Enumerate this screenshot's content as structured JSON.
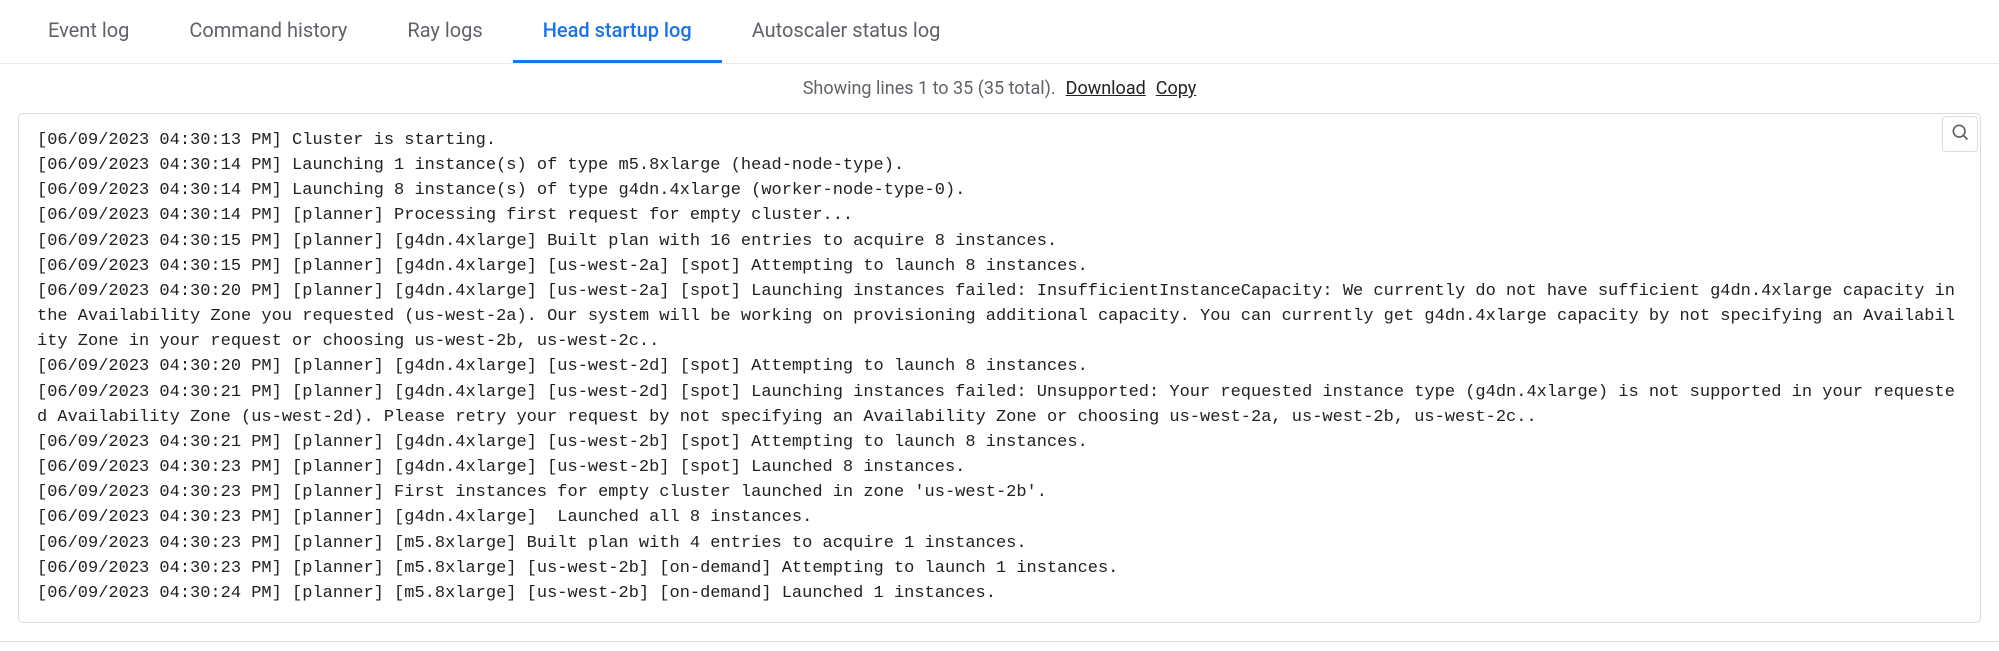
{
  "tabs": {
    "event_log": "Event log",
    "command_history": "Command history",
    "ray_logs": "Ray logs",
    "head_startup_log": "Head startup log",
    "autoscaler_status_log": "Autoscaler status log"
  },
  "meta": {
    "showing": "Showing lines 1 to 35 (35 total).",
    "download": "Download",
    "copy": "Copy"
  },
  "log": "[06/09/2023 04:30:13 PM] Cluster is starting.\n[06/09/2023 04:30:14 PM] Launching 1 instance(s) of type m5.8xlarge (head-node-type).\n[06/09/2023 04:30:14 PM] Launching 8 instance(s) of type g4dn.4xlarge (worker-node-type-0).\n[06/09/2023 04:30:14 PM] [planner] Processing first request for empty cluster...\n[06/09/2023 04:30:15 PM] [planner] [g4dn.4xlarge] Built plan with 16 entries to acquire 8 instances.\n[06/09/2023 04:30:15 PM] [planner] [g4dn.4xlarge] [us-west-2a] [spot] Attempting to launch 8 instances.\n[06/09/2023 04:30:20 PM] [planner] [g4dn.4xlarge] [us-west-2a] [spot] Launching instances failed: InsufficientInstanceCapacity: We currently do not have sufficient g4dn.4xlarge capacity in the Availability Zone you requested (us-west-2a). Our system will be working on provisioning additional capacity. You can currently get g4dn.4xlarge capacity by not specifying an Availability Zone in your request or choosing us-west-2b, us-west-2c..\n[06/09/2023 04:30:20 PM] [planner] [g4dn.4xlarge] [us-west-2d] [spot] Attempting to launch 8 instances.\n[06/09/2023 04:30:21 PM] [planner] [g4dn.4xlarge] [us-west-2d] [spot] Launching instances failed: Unsupported: Your requested instance type (g4dn.4xlarge) is not supported in your requested Availability Zone (us-west-2d). Please retry your request by not specifying an Availability Zone or choosing us-west-2a, us-west-2b, us-west-2c..\n[06/09/2023 04:30:21 PM] [planner] [g4dn.4xlarge] [us-west-2b] [spot] Attempting to launch 8 instances.\n[06/09/2023 04:30:23 PM] [planner] [g4dn.4xlarge] [us-west-2b] [spot] Launched 8 instances.\n[06/09/2023 04:30:23 PM] [planner] First instances for empty cluster launched in zone 'us-west-2b'.\n[06/09/2023 04:30:23 PM] [planner] [g4dn.4xlarge]  Launched all 8 instances.\n[06/09/2023 04:30:23 PM] [planner] [m5.8xlarge] Built plan with 4 entries to acquire 1 instances.\n[06/09/2023 04:30:23 PM] [planner] [m5.8xlarge] [us-west-2b] [on-demand] Attempting to launch 1 instances.\n[06/09/2023 04:30:24 PM] [planner] [m5.8xlarge] [us-west-2b] [on-demand] Launched 1 instances."
}
